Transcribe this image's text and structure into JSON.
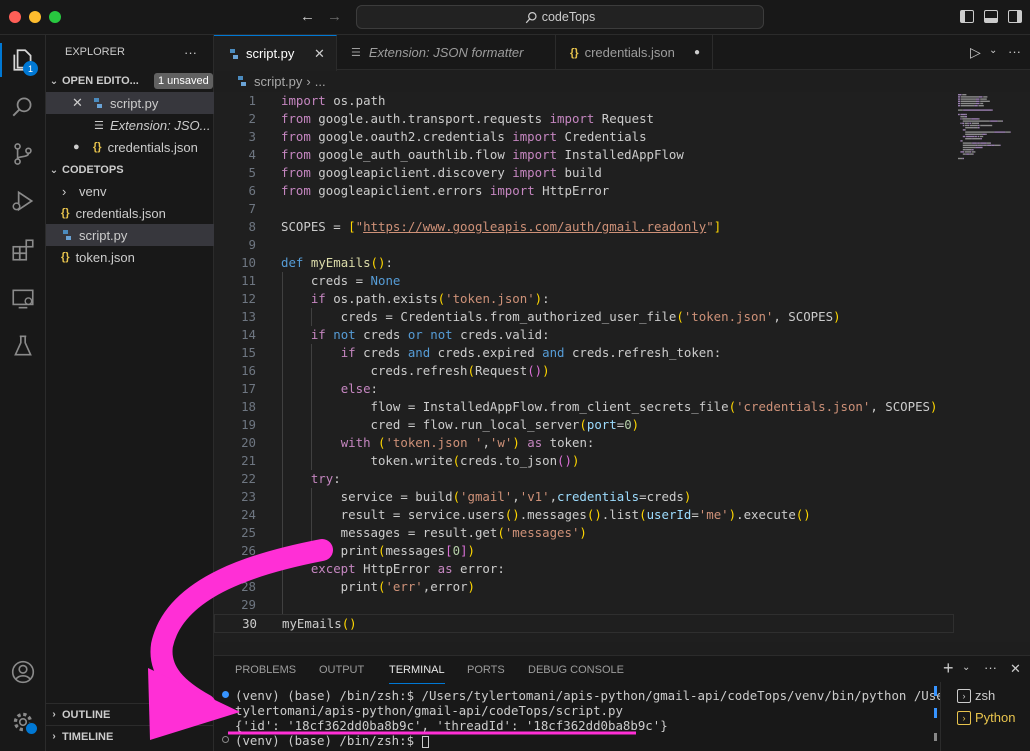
{
  "window": {
    "search_text": "codeTops"
  },
  "activity": {
    "explorer_badge": "1"
  },
  "sidebar": {
    "title": "EXPLORER",
    "more": "···",
    "open_editors_label": "OPEN EDITO...",
    "unsaved_badge": "1 unsaved",
    "open_editors": [
      {
        "label": "script.py",
        "type": "python",
        "state": "close"
      },
      {
        "label": "Extension: JSO...",
        "type": "extension",
        "state": "none"
      },
      {
        "label": "credentials.json",
        "type": "json",
        "state": "dirty"
      }
    ],
    "folder_label": "CODETOPS",
    "files": [
      {
        "label": "venv",
        "type": "folder"
      },
      {
        "label": "credentials.json",
        "type": "json"
      },
      {
        "label": "script.py",
        "type": "python"
      },
      {
        "label": "token.json",
        "type": "json"
      }
    ],
    "outline_label": "OUTLINE",
    "timeline_label": "TIMELINE"
  },
  "tabs": [
    {
      "label": "script.py",
      "active": true
    },
    {
      "label": "Extension: JSON formatter",
      "active": false
    },
    {
      "label": "credentials.json",
      "active": false
    }
  ],
  "breadcrumb": {
    "file": "script.py",
    "rest": "..."
  },
  "editor": {
    "lines": [
      [
        [
          "kw",
          "import"
        ],
        [
          "t",
          " os.path"
        ]
      ],
      [
        [
          "kw",
          "from"
        ],
        [
          "t",
          " google.auth.transport.requests "
        ],
        [
          "kw",
          "import"
        ],
        [
          "t",
          " Request"
        ]
      ],
      [
        [
          "kw",
          "from"
        ],
        [
          "t",
          " google.oauth2.credentials "
        ],
        [
          "kw",
          "import"
        ],
        [
          "t",
          " Credentials"
        ]
      ],
      [
        [
          "kw",
          "from"
        ],
        [
          "t",
          " google_auth_oauthlib.flow "
        ],
        [
          "kw",
          "import"
        ],
        [
          "t",
          " InstalledAppFlow"
        ]
      ],
      [
        [
          "kw",
          "from"
        ],
        [
          "t",
          " googleapiclient.discovery "
        ],
        [
          "kw",
          "import"
        ],
        [
          "t",
          " build"
        ]
      ],
      [
        [
          "kw",
          "from"
        ],
        [
          "t",
          " googleapiclient.errors "
        ],
        [
          "kw",
          "import"
        ],
        [
          "t",
          " HttpError"
        ]
      ],
      [],
      [
        [
          "t",
          "SCOPES = "
        ],
        [
          "br1",
          "["
        ],
        [
          "st",
          "\""
        ],
        [
          "stu",
          "https://www.googleapis.com/auth/gmail.readonly"
        ],
        [
          "st",
          "\""
        ],
        [
          "br1",
          "]"
        ]
      ],
      [],
      [
        [
          "kb",
          "def"
        ],
        [
          "t",
          " "
        ],
        [
          "fn",
          "myEmails"
        ],
        [
          "br1",
          "()"
        ],
        [
          "t",
          ":"
        ]
      ],
      [
        [
          "t",
          "    creds = "
        ],
        [
          "kb",
          "None"
        ]
      ],
      [
        [
          "t",
          "    "
        ],
        [
          "kw",
          "if"
        ],
        [
          "t",
          " os.path.exists"
        ],
        [
          "br1",
          "("
        ],
        [
          "st",
          "'token.json'"
        ],
        [
          "br1",
          ")"
        ],
        [
          "t",
          ":"
        ]
      ],
      [
        [
          "t",
          "        creds = Credentials.from_authorized_user_file"
        ],
        [
          "br1",
          "("
        ],
        [
          "st",
          "'token.json'"
        ],
        [
          "t",
          ", SCOPES"
        ],
        [
          "br1",
          ")"
        ]
      ],
      [
        [
          "t",
          "    "
        ],
        [
          "kw",
          "if"
        ],
        [
          "t",
          " "
        ],
        [
          "kb",
          "not"
        ],
        [
          "t",
          " creds "
        ],
        [
          "kb",
          "or"
        ],
        [
          "t",
          " "
        ],
        [
          "kb",
          "not"
        ],
        [
          "t",
          " creds.valid:"
        ]
      ],
      [
        [
          "t",
          "        "
        ],
        [
          "kw",
          "if"
        ],
        [
          "t",
          " creds "
        ],
        [
          "kb",
          "and"
        ],
        [
          "t",
          " creds.expired "
        ],
        [
          "kb",
          "and"
        ],
        [
          "t",
          " creds.refresh_token:"
        ]
      ],
      [
        [
          "t",
          "            creds.refresh"
        ],
        [
          "br1",
          "("
        ],
        [
          "t",
          "Request"
        ],
        [
          "br2",
          "()"
        ],
        [
          "br1",
          ")"
        ]
      ],
      [
        [
          "t",
          "        "
        ],
        [
          "kw",
          "else"
        ],
        [
          "t",
          ":"
        ]
      ],
      [
        [
          "t",
          "            flow = InstalledAppFlow.from_client_secrets_file"
        ],
        [
          "br1",
          "("
        ],
        [
          "st",
          "'credentials.json'"
        ],
        [
          "t",
          ", SCOPES"
        ],
        [
          "br1",
          ")"
        ]
      ],
      [
        [
          "t",
          "            cred = flow.run_local_server"
        ],
        [
          "br1",
          "("
        ],
        [
          "pm",
          "port"
        ],
        [
          "t",
          "="
        ],
        [
          "nm",
          "0"
        ],
        [
          "br1",
          ")"
        ]
      ],
      [
        [
          "t",
          "        "
        ],
        [
          "kw",
          "with"
        ],
        [
          "t",
          " "
        ],
        [
          "br1",
          "("
        ],
        [
          "st",
          "'token.json '"
        ],
        [
          "t",
          ","
        ],
        [
          "st",
          "'w'"
        ],
        [
          "br1",
          ")"
        ],
        [
          "t",
          " "
        ],
        [
          "kw",
          "as"
        ],
        [
          "t",
          " token:"
        ]
      ],
      [
        [
          "t",
          "            token.write"
        ],
        [
          "br1",
          "("
        ],
        [
          "t",
          "creds.to_json"
        ],
        [
          "br2",
          "()"
        ],
        [
          "br1",
          ")"
        ]
      ],
      [
        [
          "t",
          "    "
        ],
        [
          "kw",
          "try"
        ],
        [
          "t",
          ":"
        ]
      ],
      [
        [
          "t",
          "        service = build"
        ],
        [
          "br1",
          "("
        ],
        [
          "st",
          "'gmail'"
        ],
        [
          "t",
          ","
        ],
        [
          "st",
          "'v1'"
        ],
        [
          "t",
          ","
        ],
        [
          "pm",
          "credentials"
        ],
        [
          "t",
          "=creds"
        ],
        [
          "br1",
          ")"
        ]
      ],
      [
        [
          "t",
          "        result = service.users"
        ],
        [
          "br1",
          "()"
        ],
        [
          "t",
          ".messages"
        ],
        [
          "br1",
          "()"
        ],
        [
          "t",
          ".list"
        ],
        [
          "br1",
          "("
        ],
        [
          "pm",
          "userId"
        ],
        [
          "t",
          "="
        ],
        [
          "st",
          "'me'"
        ],
        [
          "br1",
          ")"
        ],
        [
          "t",
          ".execute"
        ],
        [
          "br1",
          "()"
        ]
      ],
      [
        [
          "t",
          "        messages = result.get"
        ],
        [
          "br1",
          "("
        ],
        [
          "st",
          "'messages'"
        ],
        [
          "br1",
          ")"
        ]
      ],
      [
        [
          "t",
          "        print"
        ],
        [
          "br1",
          "("
        ],
        [
          "t",
          "messages"
        ],
        [
          "br2",
          "["
        ],
        [
          "nm",
          "0"
        ],
        [
          "br2",
          "]"
        ],
        [
          "br1",
          ")"
        ]
      ],
      [
        [
          "t",
          "    "
        ],
        [
          "kw",
          "except"
        ],
        [
          "t",
          " HttpError "
        ],
        [
          "kw",
          "as"
        ],
        [
          "t",
          " error:"
        ]
      ],
      [
        [
          "t",
          "        print"
        ],
        [
          "br1",
          "("
        ],
        [
          "st",
          "'err'"
        ],
        [
          "t",
          ",error"
        ],
        [
          "br1",
          ")"
        ]
      ],
      [],
      [
        [
          "t",
          "myEmails"
        ],
        [
          "br1",
          "()"
        ]
      ]
    ]
  },
  "panel": {
    "tabs": [
      "PROBLEMS",
      "OUTPUT",
      "TERMINAL",
      "PORTS",
      "DEBUG CONSOLE"
    ],
    "active_tab": "TERMINAL",
    "terminal_lines": [
      "(venv) (base) /bin/zsh:$ /Users/tylertomani/apis-python/gmail-api/codeTops/venv/bin/python /Users/",
      "tylertomani/apis-python/gmail-api/codeTops/script.py",
      "{'id': '18cf362dd0ba8b9c', 'threadId': '18cf362dd0ba8b9c'}",
      "(venv) (base) /bin/zsh:$ "
    ],
    "terminals": [
      {
        "label": "zsh",
        "active": false
      },
      {
        "label": "Python",
        "active": true
      }
    ]
  },
  "colors": {
    "accent": "#0078d4",
    "annotation": "#ff2fd6"
  }
}
